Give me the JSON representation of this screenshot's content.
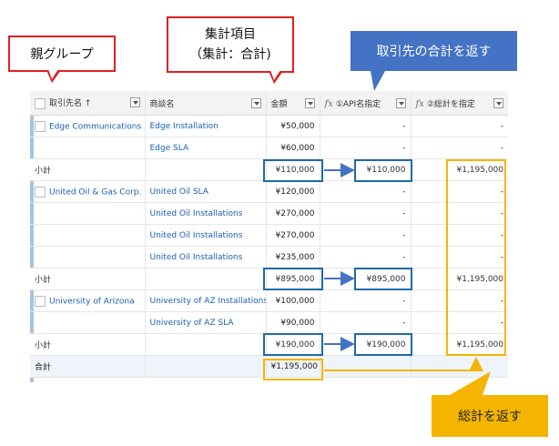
{
  "callouts": {
    "parent_group": "親グループ",
    "aggregate_line1": "集計項目",
    "aggregate_line2": "（集計：合計)",
    "returns_account_total": "取引先の合計を返す",
    "returns_grand_total": "総計を返す"
  },
  "table": {
    "headers": {
      "account": "取引先名",
      "sort_indicator": "↑",
      "opportunity": "商談名",
      "amount": "金額",
      "formula1": "①API名指定",
      "formula2": "②総計を指定"
    },
    "rows": [
      {
        "type": "data",
        "account": "Edge Communications",
        "opportunity": "Edge Installation",
        "amount": "¥50,000",
        "f1": "-",
        "f2": "-"
      },
      {
        "type": "data",
        "account": "",
        "opportunity": "Edge SLA",
        "amount": "¥60,000",
        "f1": "-",
        "f2": "-"
      },
      {
        "type": "subtotal",
        "label": "小計",
        "amount": "¥110,000",
        "f1": "¥110,000",
        "f2": "¥1,195,000"
      },
      {
        "type": "data",
        "account": "United Oil & Gas Corp.",
        "opportunity": "United Oil SLA",
        "amount": "¥120,000",
        "f1": "-",
        "f2": "-"
      },
      {
        "type": "data",
        "account": "",
        "opportunity": "United Oil Installations",
        "amount": "¥270,000",
        "f1": "-",
        "f2": "-"
      },
      {
        "type": "data",
        "account": "",
        "opportunity": "United Oil Installations",
        "amount": "¥270,000",
        "f1": "-",
        "f2": "-"
      },
      {
        "type": "data",
        "account": "",
        "opportunity": "United Oil Installations",
        "amount": "¥235,000",
        "f1": "-",
        "f2": "-"
      },
      {
        "type": "subtotal",
        "label": "小計",
        "amount": "¥895,000",
        "f1": "¥895,000",
        "f2": "¥1,195,000"
      },
      {
        "type": "data",
        "account": "University of Arizona",
        "opportunity": "University of AZ Installations",
        "amount": "¥100,000",
        "f1": "-",
        "f2": "-"
      },
      {
        "type": "data",
        "account": "",
        "opportunity": "University of AZ SLA",
        "amount": "¥90,000",
        "f1": "-",
        "f2": "-"
      },
      {
        "type": "subtotal",
        "label": "小計",
        "amount": "¥190,000",
        "f1": "¥190,000",
        "f2": "¥1,195,000"
      },
      {
        "type": "grand",
        "label": "合計",
        "amount": "¥1,195,000",
        "f1": "",
        "f2": ""
      }
    ]
  },
  "colors": {
    "highlight_blue": "#1f6aa5",
    "highlight_yellow": "#f5b400",
    "callout_blue": "#4472c4",
    "callout_red": "#e02020"
  }
}
